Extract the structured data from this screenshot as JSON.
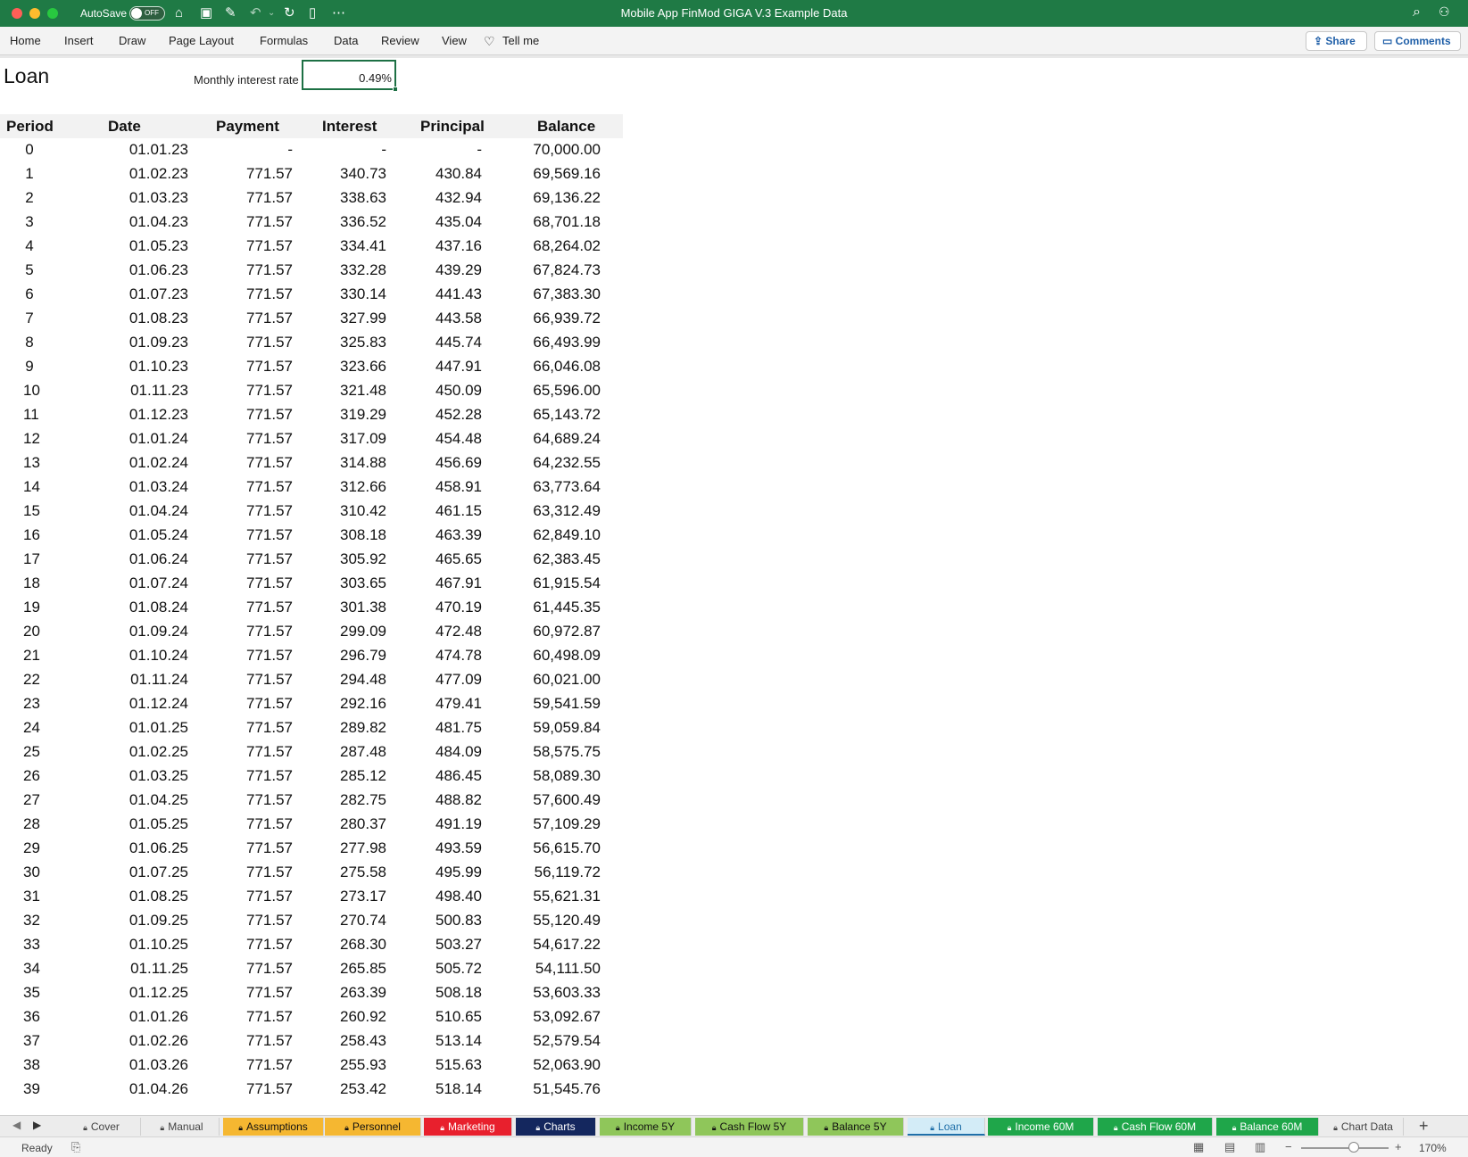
{
  "titlebar": {
    "autosave_label": "AutoSave",
    "autosave_state": "OFF",
    "document_title": "Mobile App FinMod GIGA V.3 Example Data",
    "accent_color": "#1f7a45"
  },
  "ribbon": {
    "tabs": [
      "Home",
      "Insert",
      "Draw",
      "Page Layout",
      "Formulas",
      "Data",
      "Review",
      "View"
    ],
    "tell_me": "Tell me",
    "share_label": "Share",
    "comments_label": "Comments"
  },
  "sheet": {
    "title": "Loan",
    "rate_label": "Monthly interest rate",
    "rate_value": "0.49%",
    "headers": [
      "Period",
      "Date",
      "Payment",
      "Interest",
      "Principal",
      "Balance"
    ],
    "rows": [
      [
        "0",
        "01.01.23",
        "-",
        "-",
        "-",
        "70,000.00"
      ],
      [
        "1",
        "01.02.23",
        "771.57",
        "340.73",
        "430.84",
        "69,569.16"
      ],
      [
        "2",
        "01.03.23",
        "771.57",
        "338.63",
        "432.94",
        "69,136.22"
      ],
      [
        "3",
        "01.04.23",
        "771.57",
        "336.52",
        "435.04",
        "68,701.18"
      ],
      [
        "4",
        "01.05.23",
        "771.57",
        "334.41",
        "437.16",
        "68,264.02"
      ],
      [
        "5",
        "01.06.23",
        "771.57",
        "332.28",
        "439.29",
        "67,824.73"
      ],
      [
        "6",
        "01.07.23",
        "771.57",
        "330.14",
        "441.43",
        "67,383.30"
      ],
      [
        "7",
        "01.08.23",
        "771.57",
        "327.99",
        "443.58",
        "66,939.72"
      ],
      [
        "8",
        "01.09.23",
        "771.57",
        "325.83",
        "445.74",
        "66,493.99"
      ],
      [
        "9",
        "01.10.23",
        "771.57",
        "323.66",
        "447.91",
        "66,046.08"
      ],
      [
        "10",
        "01.11.23",
        "771.57",
        "321.48",
        "450.09",
        "65,596.00"
      ],
      [
        "11",
        "01.12.23",
        "771.57",
        "319.29",
        "452.28",
        "65,143.72"
      ],
      [
        "12",
        "01.01.24",
        "771.57",
        "317.09",
        "454.48",
        "64,689.24"
      ],
      [
        "13",
        "01.02.24",
        "771.57",
        "314.88",
        "456.69",
        "64,232.55"
      ],
      [
        "14",
        "01.03.24",
        "771.57",
        "312.66",
        "458.91",
        "63,773.64"
      ],
      [
        "15",
        "01.04.24",
        "771.57",
        "310.42",
        "461.15",
        "63,312.49"
      ],
      [
        "16",
        "01.05.24",
        "771.57",
        "308.18",
        "463.39",
        "62,849.10"
      ],
      [
        "17",
        "01.06.24",
        "771.57",
        "305.92",
        "465.65",
        "62,383.45"
      ],
      [
        "18",
        "01.07.24",
        "771.57",
        "303.65",
        "467.91",
        "61,915.54"
      ],
      [
        "19",
        "01.08.24",
        "771.57",
        "301.38",
        "470.19",
        "61,445.35"
      ],
      [
        "20",
        "01.09.24",
        "771.57",
        "299.09",
        "472.48",
        "60,972.87"
      ],
      [
        "21",
        "01.10.24",
        "771.57",
        "296.79",
        "474.78",
        "60,498.09"
      ],
      [
        "22",
        "01.11.24",
        "771.57",
        "294.48",
        "477.09",
        "60,021.00"
      ],
      [
        "23",
        "01.12.24",
        "771.57",
        "292.16",
        "479.41",
        "59,541.59"
      ],
      [
        "24",
        "01.01.25",
        "771.57",
        "289.82",
        "481.75",
        "59,059.84"
      ],
      [
        "25",
        "01.02.25",
        "771.57",
        "287.48",
        "484.09",
        "58,575.75"
      ],
      [
        "26",
        "01.03.25",
        "771.57",
        "285.12",
        "486.45",
        "58,089.30"
      ],
      [
        "27",
        "01.04.25",
        "771.57",
        "282.75",
        "488.82",
        "57,600.49"
      ],
      [
        "28",
        "01.05.25",
        "771.57",
        "280.37",
        "491.19",
        "57,109.29"
      ],
      [
        "29",
        "01.06.25",
        "771.57",
        "277.98",
        "493.59",
        "56,615.70"
      ],
      [
        "30",
        "01.07.25",
        "771.57",
        "275.58",
        "495.99",
        "56,119.72"
      ],
      [
        "31",
        "01.08.25",
        "771.57",
        "273.17",
        "498.40",
        "55,621.31"
      ],
      [
        "32",
        "01.09.25",
        "771.57",
        "270.74",
        "500.83",
        "55,120.49"
      ],
      [
        "33",
        "01.10.25",
        "771.57",
        "268.30",
        "503.27",
        "54,617.22"
      ],
      [
        "34",
        "01.11.25",
        "771.57",
        "265.85",
        "505.72",
        "54,111.50"
      ],
      [
        "35",
        "01.12.25",
        "771.57",
        "263.39",
        "508.18",
        "53,603.33"
      ],
      [
        "36",
        "01.01.26",
        "771.57",
        "260.92",
        "510.65",
        "53,092.67"
      ],
      [
        "37",
        "01.02.26",
        "771.57",
        "258.43",
        "513.14",
        "52,579.54"
      ],
      [
        "38",
        "01.03.26",
        "771.57",
        "255.93",
        "515.63",
        "52,063.90"
      ],
      [
        "39",
        "01.04.26",
        "771.57",
        "253.42",
        "518.14",
        "51,545.76"
      ]
    ]
  },
  "sheet_tabs": [
    {
      "label": "Cover",
      "color": "#ececec",
      "text": "#444444",
      "locked": true
    },
    {
      "label": "Manual",
      "color": "#ececec",
      "text": "#444444",
      "locked": true
    },
    {
      "label": "Assumptions",
      "color": "#f5b731",
      "text": "#111111",
      "locked": true
    },
    {
      "label": "Personnel",
      "color": "#f5b731",
      "text": "#111111",
      "locked": true
    },
    {
      "label": "Marketing",
      "color": "#e8202d",
      "text": "#ffffff",
      "locked": true
    },
    {
      "label": "Charts",
      "color": "#14275e",
      "text": "#ffffff",
      "locked": true
    },
    {
      "label": "Income 5Y",
      "color": "#8fc65a",
      "text": "#111111",
      "locked": true
    },
    {
      "label": "Cash Flow 5Y",
      "color": "#8fc65a",
      "text": "#111111",
      "locked": true
    },
    {
      "label": "Balance 5Y",
      "color": "#8fc65a",
      "text": "#111111",
      "locked": true
    },
    {
      "label": "Loan",
      "color": "#d3ecf7",
      "text": "#1f6fa8",
      "locked": true
    },
    {
      "label": "Income 60M",
      "color": "#1fa64a",
      "text": "#ffffff",
      "locked": true
    },
    {
      "label": "Cash Flow 60M",
      "color": "#1fa64a",
      "text": "#ffffff",
      "locked": true
    },
    {
      "label": "Balance 60M",
      "color": "#1fa64a",
      "text": "#ffffff",
      "locked": true
    },
    {
      "label": "Chart Data",
      "color": "#ececec",
      "text": "#444444",
      "locked": true
    }
  ],
  "statusbar": {
    "ready": "Ready",
    "zoom": "170%"
  }
}
